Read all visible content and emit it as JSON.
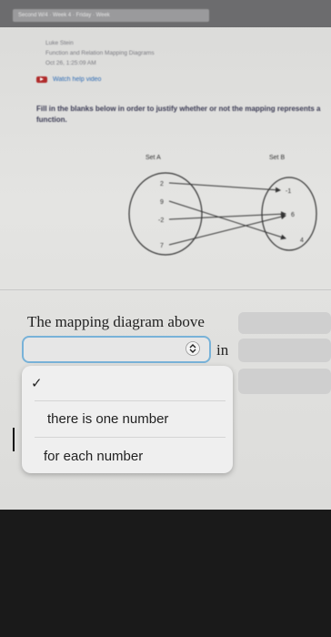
{
  "breadcrumb": "Second W/4 · Week 4 · Friday · Week",
  "meta": {
    "student": "Luke Stein",
    "topic": "Function and Relation Mapping Diagrams",
    "date": "Oct 26, 1:25:09 AM"
  },
  "help": {
    "label": "Watch help video"
  },
  "instruction": "Fill in the blanks below in order to justify whether or not the mapping represents a function.",
  "diagram": {
    "set_a_label": "Set A",
    "set_b_label": "Set B",
    "set_a": [
      "2",
      "9",
      "-2",
      "7"
    ],
    "set_b": [
      "-1",
      "6",
      "4"
    ]
  },
  "question": {
    "text": "The mapping diagram above",
    "after_select": "in"
  },
  "dropdown": {
    "selected_check": "✓",
    "options": [
      "there is one number",
      "for each number"
    ]
  },
  "colors": {
    "select_border": "#78b2d8",
    "help_icon": "#b02b2b",
    "link": "#2f6cb5"
  }
}
